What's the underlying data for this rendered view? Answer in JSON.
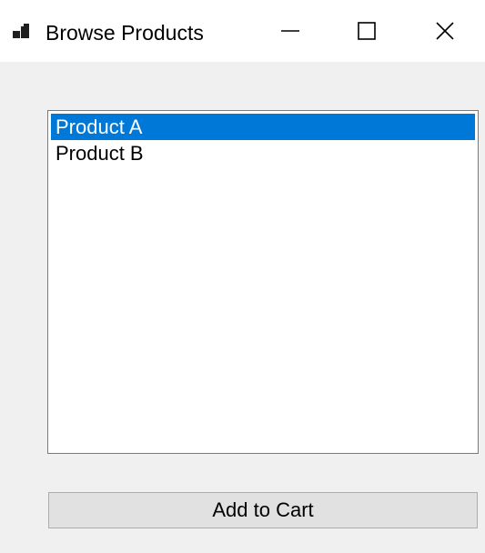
{
  "window": {
    "title": "Browse Products",
    "controls": {
      "minimize_icon": "minimize-icon",
      "maximize_icon": "maximize-icon",
      "close_icon": "close-icon"
    }
  },
  "products": {
    "items": [
      {
        "label": "Product A",
        "selected": true
      },
      {
        "label": "Product B",
        "selected": false
      }
    ]
  },
  "actions": {
    "add_to_cart_label": "Add to Cart"
  },
  "colors": {
    "selection": "#0078d7",
    "window_bg": "#f0f0f0",
    "button_bg": "#e1e1e1"
  }
}
